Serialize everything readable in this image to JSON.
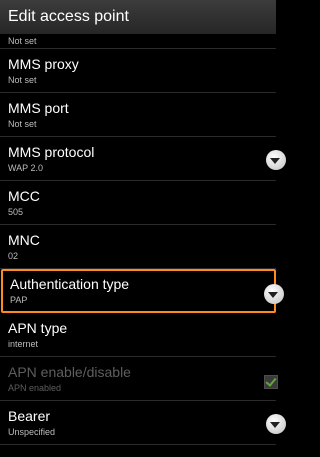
{
  "header": {
    "title": "Edit access point"
  },
  "rows": [
    {
      "title": "",
      "subtitle": "Not set"
    },
    {
      "title": "MMS proxy",
      "subtitle": "Not set"
    },
    {
      "title": "MMS port",
      "subtitle": "Not set"
    },
    {
      "title": "MMS protocol",
      "subtitle": "WAP 2.0",
      "control": "dropdown-icon"
    },
    {
      "title": "MCC",
      "subtitle": "505"
    },
    {
      "title": "MNC",
      "subtitle": "02"
    },
    {
      "title": "Authentication type",
      "subtitle": "PAP",
      "control": "dropdown-icon",
      "selected": true
    },
    {
      "title": "APN type",
      "subtitle": "internet"
    },
    {
      "title": "APN enable/disable",
      "subtitle": "APN enabled",
      "control": "checkbox",
      "checked": true,
      "enabled": false
    },
    {
      "title": "Bearer",
      "subtitle": "Unspecified",
      "control": "dropdown-icon"
    }
  ],
  "colors": {
    "accent": "#ff8a1f",
    "background": "#000000",
    "check": "#5fa832"
  }
}
